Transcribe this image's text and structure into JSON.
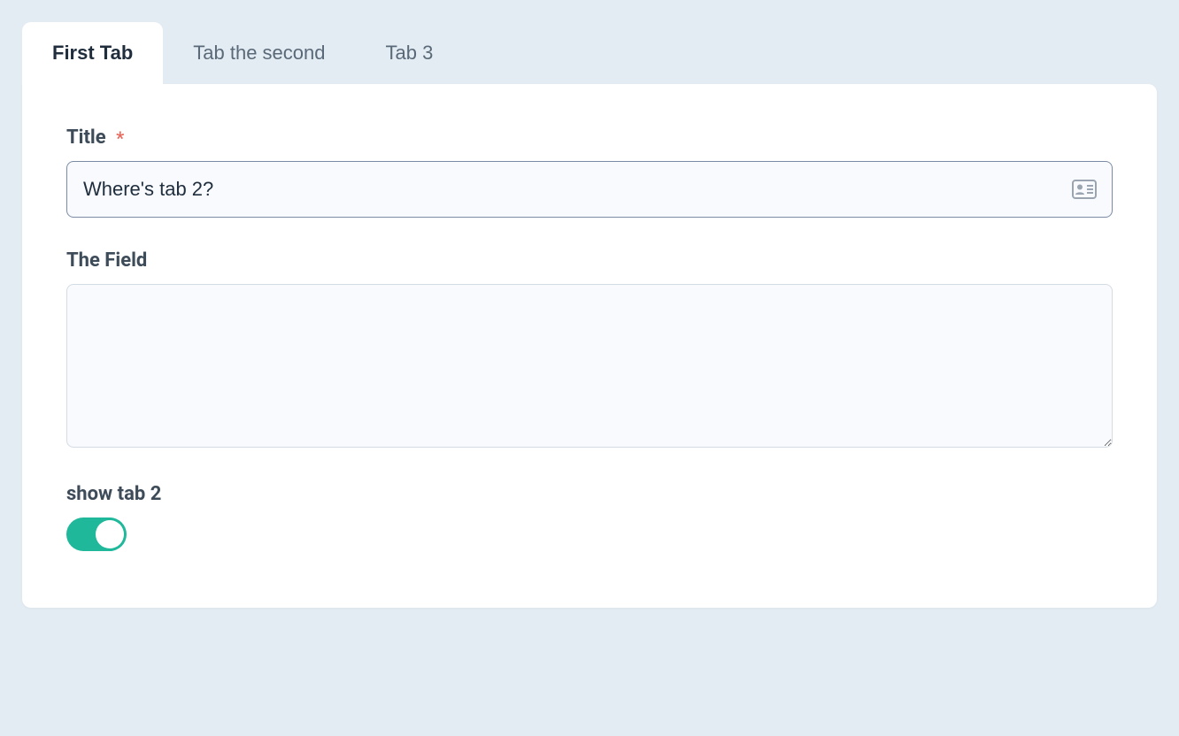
{
  "tabs": [
    {
      "label": "First Tab",
      "active": true
    },
    {
      "label": "Tab the second",
      "active": false
    },
    {
      "label": "Tab 3",
      "active": false
    }
  ],
  "form": {
    "title": {
      "label": "Title",
      "required": true,
      "value": "Where's tab 2?"
    },
    "theField": {
      "label": "The Field",
      "value": ""
    },
    "showTab2": {
      "label": "show tab 2",
      "value": true
    }
  },
  "colors": {
    "toggleOn": "#1fb89a",
    "requiredAsterisk": "#e86a5e"
  }
}
